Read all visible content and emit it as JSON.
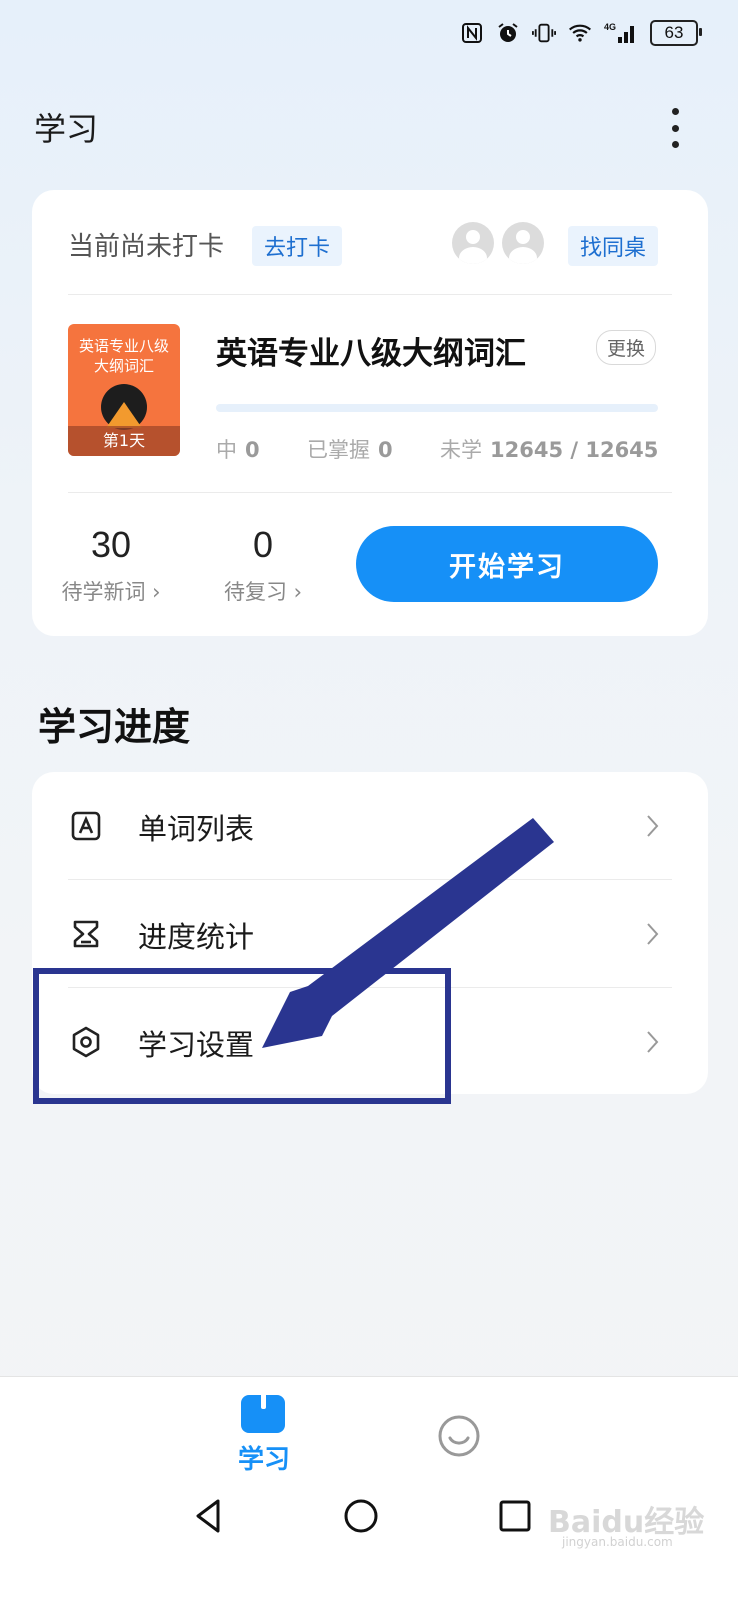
{
  "status_bar": {
    "icons": [
      "nfc-icon",
      "alarm-icon",
      "vibrate-icon",
      "wifi-icon",
      "signal-4g-icon"
    ],
    "network": "4G",
    "battery": "63"
  },
  "header": {
    "title": "学习",
    "more_icon": "more-vertical-icon"
  },
  "checkin_card": {
    "status_text": "当前尚未打卡",
    "checkin_label": "去打卡",
    "find_partner_label": "找同桌",
    "book": {
      "cover_title": "英语专业八级大纲词汇",
      "cover_day": "第1天",
      "title": "英语专业八级大纲词汇",
      "change_label": "更换",
      "progress": 0,
      "learning_label": "中",
      "learning_value": "0",
      "mastered_label": "已掌握",
      "mastered_value": "0",
      "unlearned_label": "未学",
      "unlearned_value": "12645 / 12645"
    },
    "new_words_count": "30",
    "new_words_label": "待学新词 ›",
    "review_count": "0",
    "review_label": "待复习 ›",
    "start_label": "开始学习"
  },
  "progress_section": {
    "title": "学习进度",
    "items": [
      {
        "label": "单词列表",
        "icon": "word-list-icon"
      },
      {
        "label": "进度统计",
        "icon": "hourglass-icon"
      },
      {
        "label": "学习设置",
        "icon": "settings-hexagon-icon"
      }
    ]
  },
  "bottom_nav": {
    "tabs": [
      {
        "label": "学习",
        "icon": "book-icon",
        "active": true
      },
      {
        "label": "",
        "icon": "smiley-icon",
        "active": false
      }
    ],
    "accent": "#1690f7"
  },
  "system_nav": [
    "back-icon",
    "home-icon",
    "recents-icon"
  ],
  "annotation": {
    "color": "#2a3590"
  },
  "watermark": {
    "text": "Baidu经验",
    "sub": "jingyan.baidu.com"
  }
}
